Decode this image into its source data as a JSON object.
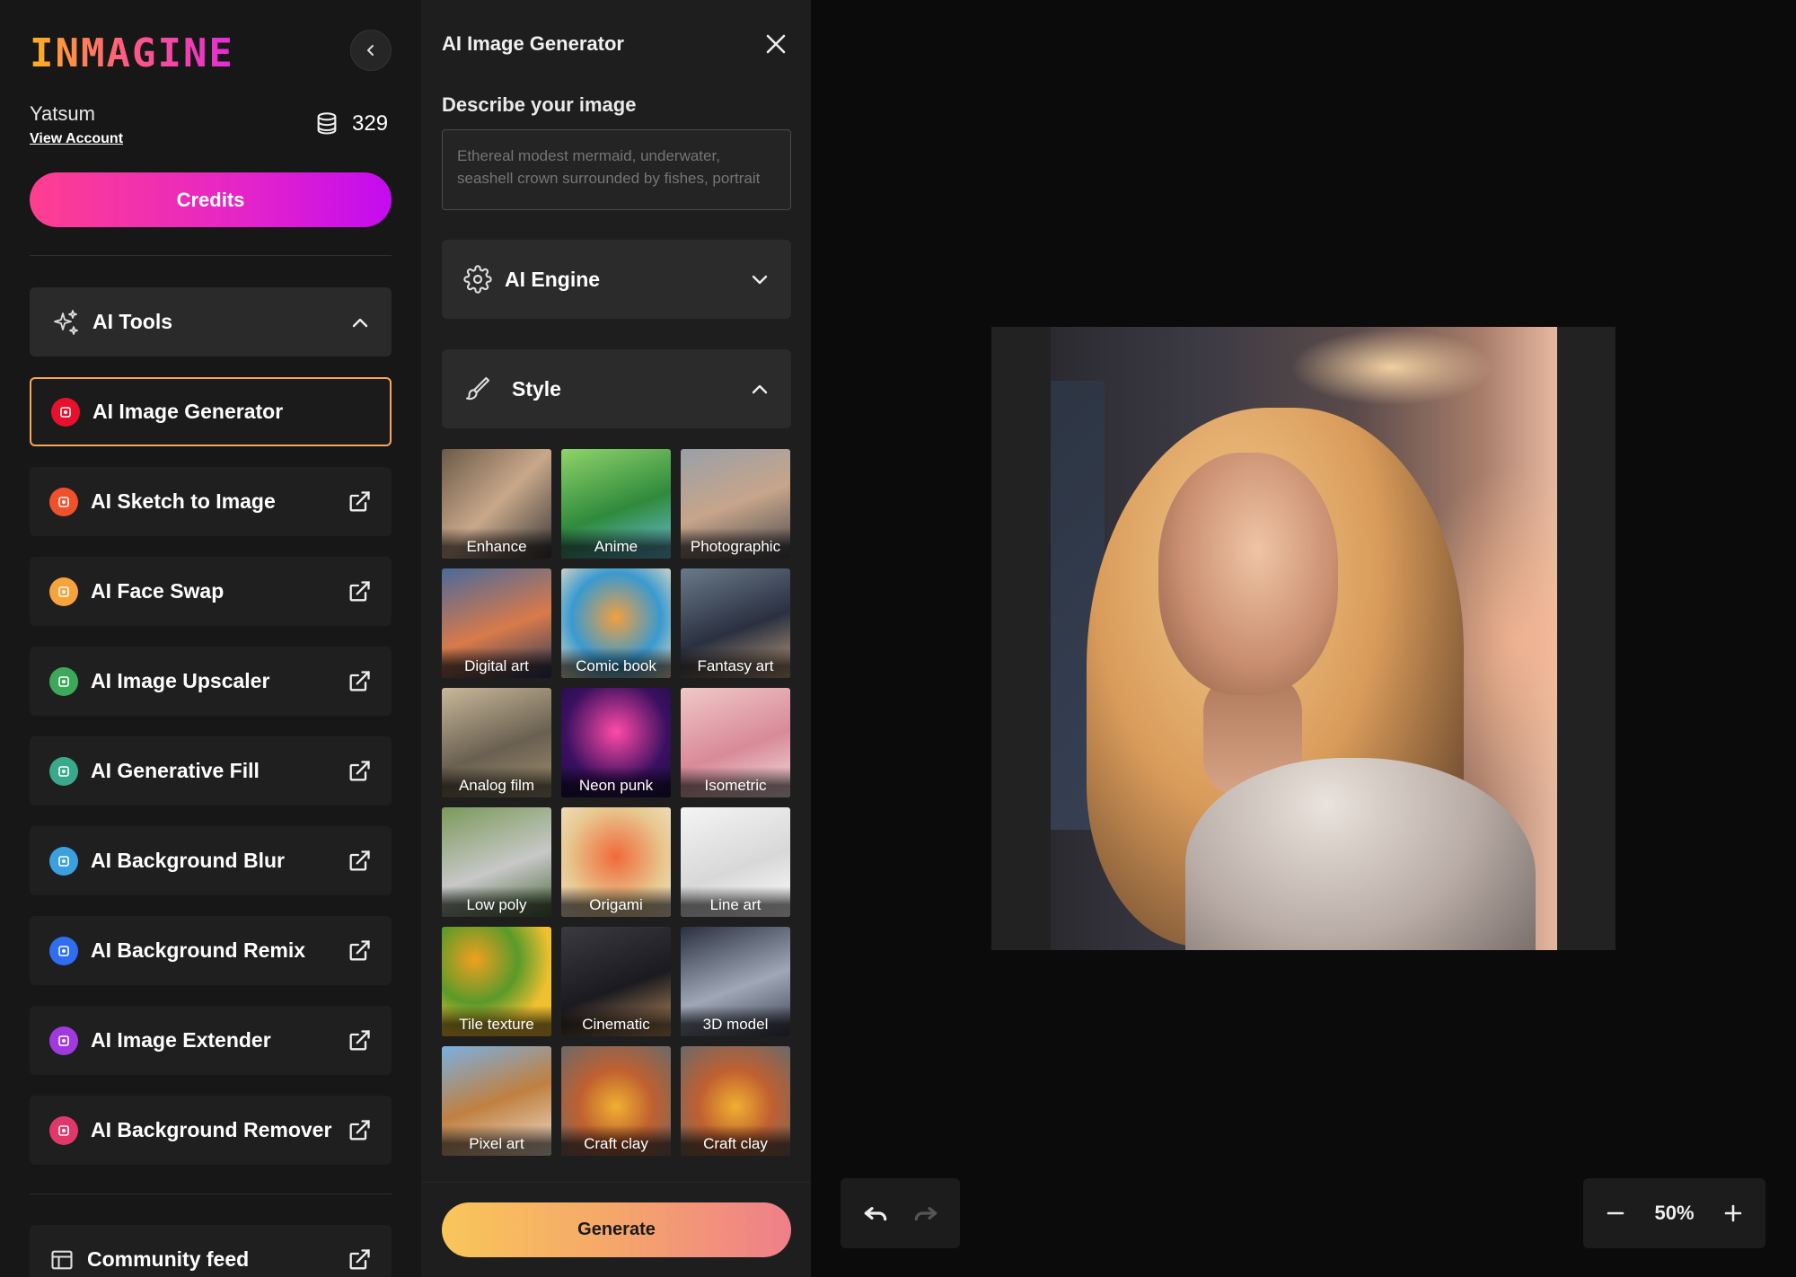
{
  "brand": {
    "logo_text": "INMAGINE"
  },
  "account": {
    "name": "Yatsum",
    "view_account": "View Account",
    "credits": "329",
    "credits_button": "Credits"
  },
  "tools": {
    "header": "AI Tools",
    "items": [
      {
        "label": "AI Image Generator",
        "color": "#e8112d",
        "active": true
      },
      {
        "label": "AI Sketch to Image",
        "color": "#f0502a"
      },
      {
        "label": "AI Face Swap",
        "color": "#f5a33a"
      },
      {
        "label": "AI Image Upscaler",
        "color": "#3ea85a"
      },
      {
        "label": "AI Generative Fill",
        "color": "#3aa88a"
      },
      {
        "label": "AI Background Blur",
        "color": "#3aa0e0"
      },
      {
        "label": "AI Background Remix",
        "color": "#2f6ef0"
      },
      {
        "label": "AI Image Extender",
        "color": "#a03ae0"
      },
      {
        "label": "AI Background Remover",
        "color": "#e0386a"
      }
    ],
    "community_feed": "Community feed"
  },
  "panel": {
    "title": "AI Image Generator",
    "describe_label": "Describe your image",
    "prompt_placeholder": "Ethereal modest mermaid, underwater, seashell crown surrounded by fishes, portrait",
    "ai_engine_label": "AI Engine",
    "style_label": "Style",
    "styles": [
      {
        "label": "Enhance",
        "bg": "linear-gradient(135deg,#6b5a48,#c9a88a 50%,#3d3a3a)"
      },
      {
        "label": "Anime",
        "bg": "linear-gradient(160deg,#8fd46a,#2f8a3c 55%,#6bbfe0)"
      },
      {
        "label": "Photographic",
        "bg": "linear-gradient(160deg,#9aa0a8,#c7a58a 50%,#4a4a50)"
      },
      {
        "label": "Digital art",
        "bg": "linear-gradient(160deg,#4a6a9a,#d97a4a 55%,#2a3a5a)"
      },
      {
        "label": "Comic book",
        "bg": "radial-gradient(circle at 50% 45%,#f0a040,#3a9ad0 55%,#f0e0c0)"
      },
      {
        "label": "Fantasy art",
        "bg": "linear-gradient(160deg,#6a7a8a,#2a3040 55%,#c0a080)"
      },
      {
        "label": "Analog film",
        "bg": "linear-gradient(160deg,#c8b89a,#6a6050 55%,#a09070)"
      },
      {
        "label": "Neon punk",
        "bg": "radial-gradient(circle at 50% 40%,#ff4aa8,#3a1060 60%,#1a1040)"
      },
      {
        "label": "Isometric",
        "bg": "linear-gradient(160deg,#f0c8c8,#d88a98 55%,#f6e0e0)"
      },
      {
        "label": "Low poly",
        "bg": "linear-gradient(160deg,#7a9a5a,#c8c8c8 55%,#4a6a3a)"
      },
      {
        "label": "Origami",
        "bg": "radial-gradient(circle at 50% 45%,#f06a3a,#e8c890 60%,#f0e0c8)"
      },
      {
        "label": "Line art",
        "bg": "linear-gradient(160deg,#f4f4f4,#d8d8d8 55%,#ffffff)"
      },
      {
        "label": "Tile texture",
        "bg": "radial-gradient(circle at 30% 30%,#f0a020,#5a9a2a 40%,#f0c030 70%)"
      },
      {
        "label": "Cinematic",
        "bg": "linear-gradient(160deg,#3a3a40,#1a1a20 55%,#c09060)"
      },
      {
        "label": "3D model",
        "bg": "linear-gradient(160deg,#2a3040,#a0a8b8 55%,#3a4050)"
      },
      {
        "label": "Pixel art",
        "bg": "linear-gradient(160deg,#7ab0e0,#c08040 50%,#f0e0d0)"
      },
      {
        "label": "Craft clay",
        "bg": "radial-gradient(circle at 50% 55%,#f0b030,#c06030 45%,#6a6a6a)"
      },
      {
        "label": "Craft clay",
        "bg": "radial-gradient(circle at 50% 55%,#f0b030,#c06030 45%,#6a6a6a)"
      }
    ],
    "generate_button": "Generate"
  },
  "canvas": {
    "zoom": "50%"
  }
}
